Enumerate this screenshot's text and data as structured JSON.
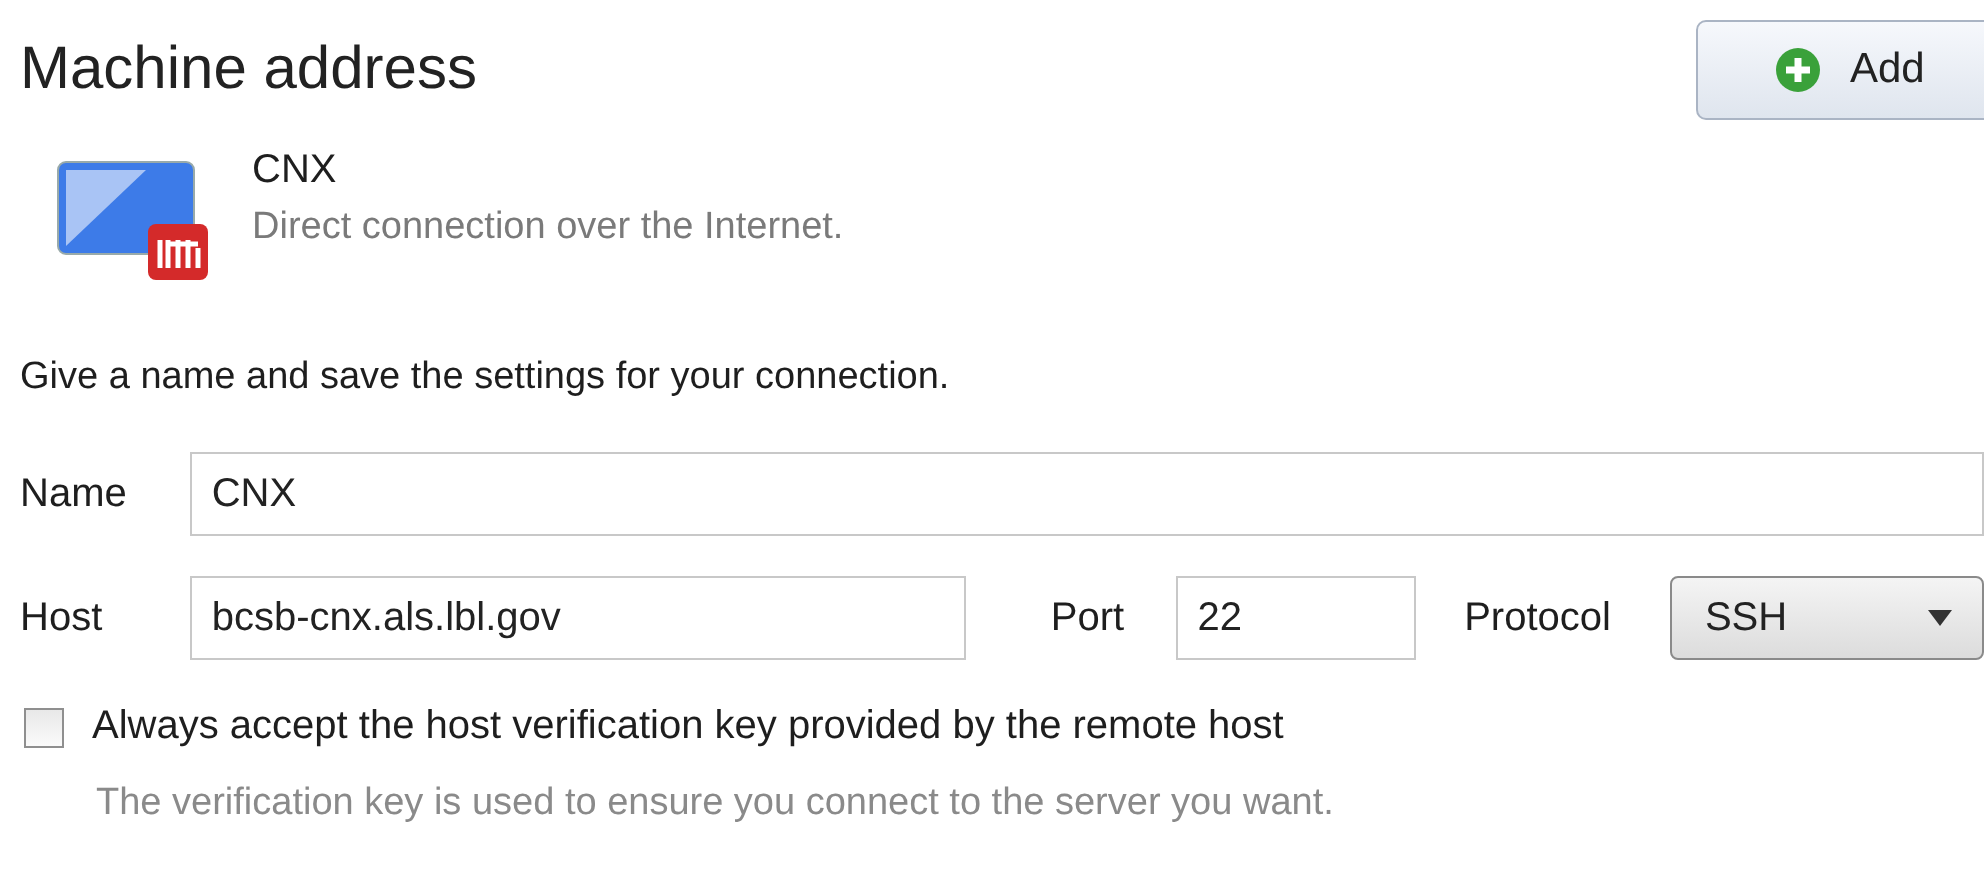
{
  "header": {
    "title": "Machine address",
    "add_button": "Add"
  },
  "connection": {
    "name": "CNX",
    "description": "Direct connection over the Internet."
  },
  "instruction": "Give a name and save the settings for your connection.",
  "fields": {
    "name": {
      "label": "Name",
      "value": "CNX"
    },
    "host": {
      "label": "Host",
      "value": "bcsb-cnx.als.lbl.gov"
    },
    "port": {
      "label": "Port",
      "value": "22"
    },
    "protocol": {
      "label": "Protocol",
      "value": "SSH"
    }
  },
  "always_accept": {
    "label": "Always accept the host verification key provided by the remote host",
    "checked": false,
    "note": "The verification key is used to ensure you connect to the server you want."
  }
}
